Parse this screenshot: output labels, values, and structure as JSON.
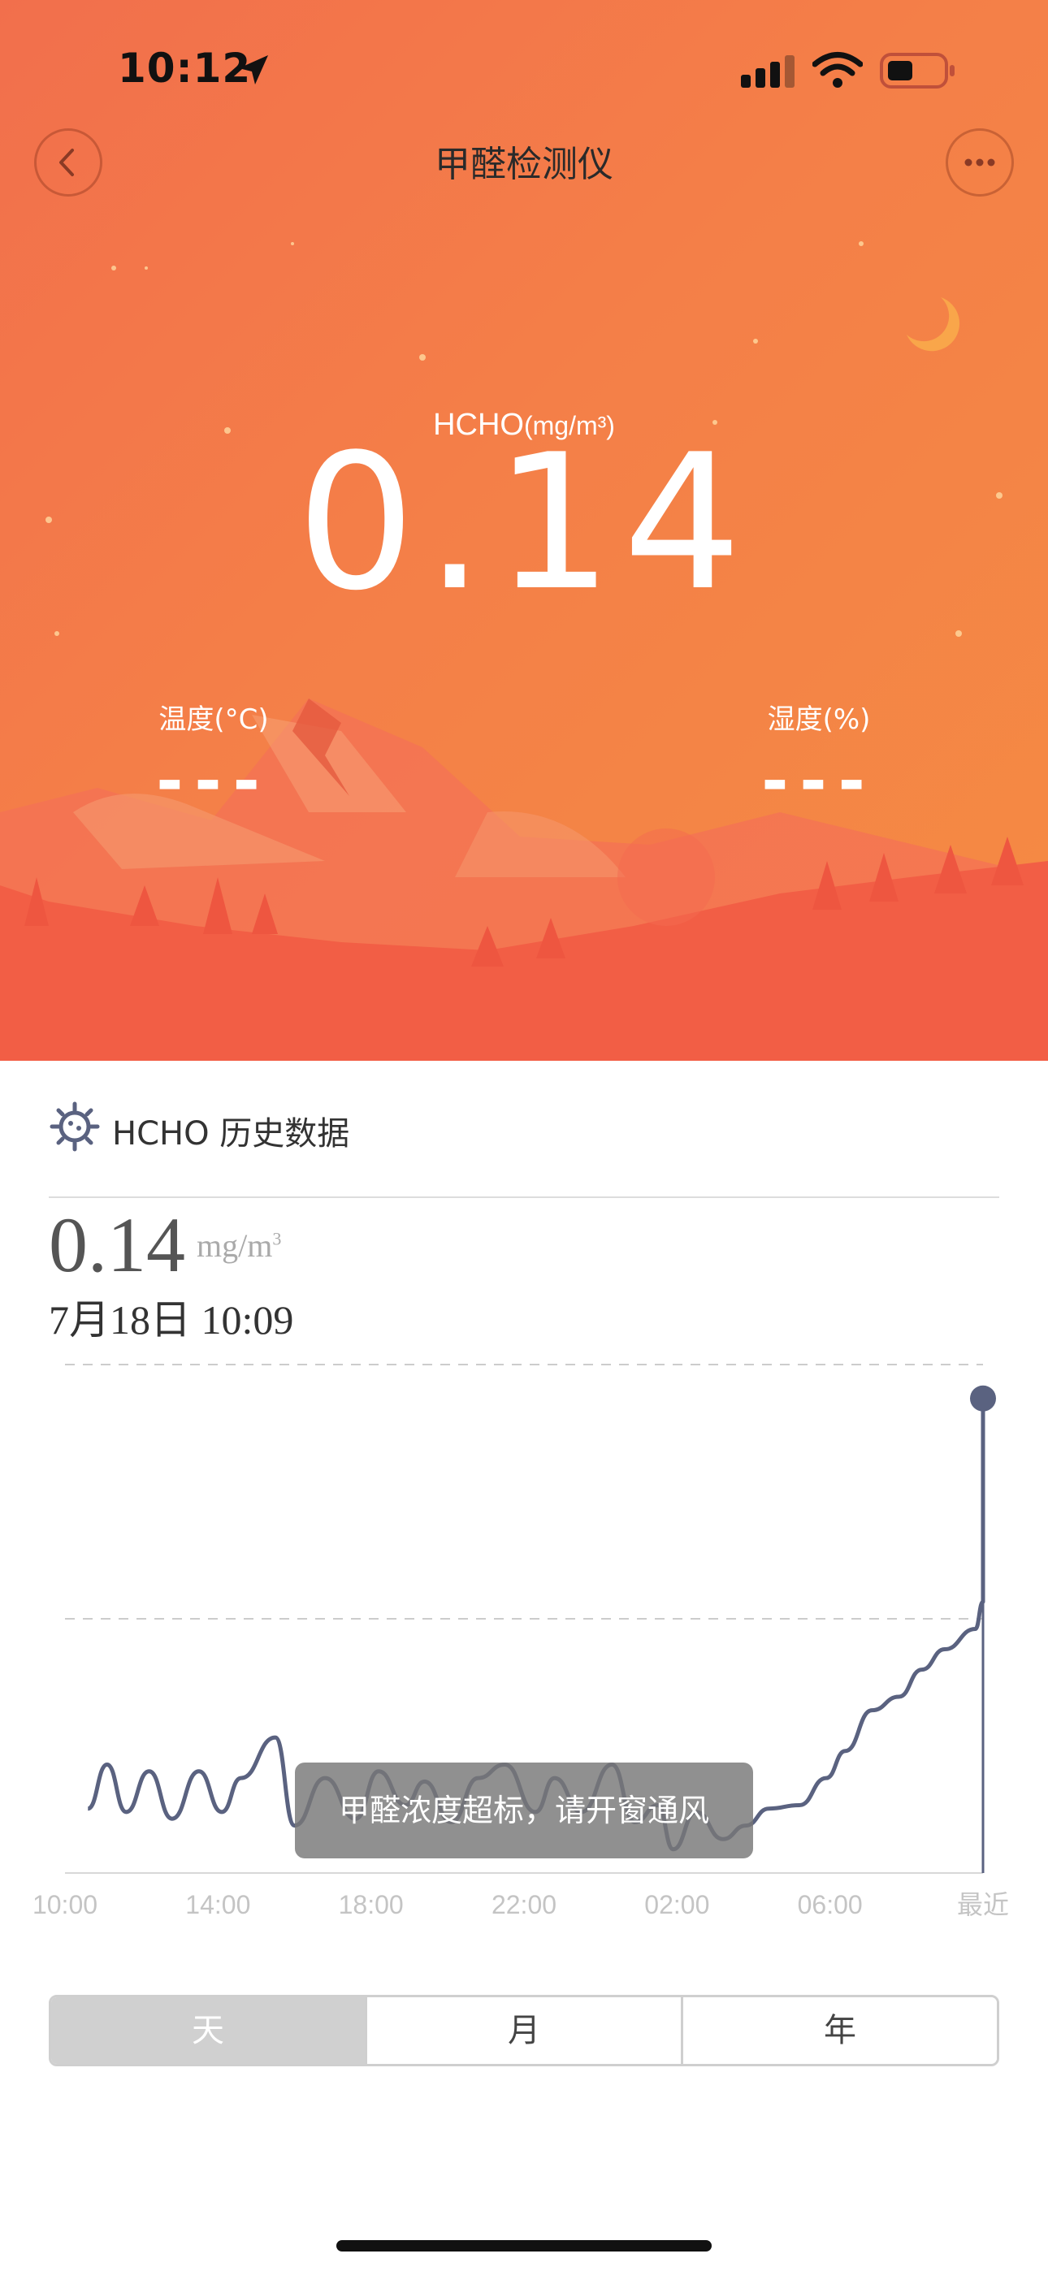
{
  "status_bar": {
    "time": "10:12",
    "icons": [
      "location-arrow-icon",
      "signal-icon",
      "wifi-icon",
      "battery-icon"
    ]
  },
  "nav": {
    "title": "甲醛检测仪",
    "back_icon": "chevron-left-icon",
    "more_icon": "ellipsis-icon"
  },
  "reading": {
    "label": "HCHO",
    "unit": "(mg/m³)",
    "value": "0.14"
  },
  "metrics": {
    "temperature_label": "温度(°C)",
    "temperature_value": "---",
    "humidity_label": "湿度(%)",
    "humidity_value": "---"
  },
  "history": {
    "title": "HCHO 历史数据",
    "icon": "gear-icon",
    "current_value": "0.14",
    "current_unit": "mg/m",
    "current_unit_sup": "3",
    "current_date": "7月18日 10:09"
  },
  "chart_data": {
    "type": "line",
    "x_labels": [
      "10:00",
      "14:00",
      "18:00",
      "22:00",
      "02:00",
      "06:00",
      "最近"
    ],
    "x_range": [
      0,
      24
    ],
    "y_range": [
      0,
      0.15
    ],
    "series": [
      {
        "values": [
          [
            0.6,
            0.019
          ],
          [
            1.1,
            0.032
          ],
          [
            1.6,
            0.018
          ],
          [
            2.2,
            0.03
          ],
          [
            2.8,
            0.016
          ],
          [
            3.5,
            0.03
          ],
          [
            4.1,
            0.018
          ],
          [
            4.6,
            0.028
          ],
          [
            5.5,
            0.04
          ],
          [
            6.0,
            0.014
          ],
          [
            6.8,
            0.028
          ],
          [
            7.6,
            0.016
          ],
          [
            8.2,
            0.03
          ],
          [
            8.9,
            0.02
          ],
          [
            9.4,
            0.027
          ],
          [
            10.1,
            0.015
          ],
          [
            10.8,
            0.028
          ],
          [
            11.5,
            0.032
          ],
          [
            12.3,
            0.018
          ],
          [
            12.8,
            0.028
          ],
          [
            13.5,
            0.018
          ],
          [
            14.3,
            0.032
          ],
          [
            14.9,
            0.015
          ],
          [
            15.5,
            0.02
          ],
          [
            15.9,
            0.007
          ],
          [
            16.5,
            0.018
          ],
          [
            17.2,
            0.01
          ],
          [
            17.8,
            0.014
          ],
          [
            18.4,
            0.019
          ],
          [
            19.2,
            0.02
          ],
          [
            19.9,
            0.028
          ],
          [
            20.4,
            0.036
          ],
          [
            21.1,
            0.048
          ],
          [
            21.8,
            0.052
          ],
          [
            22.4,
            0.06
          ],
          [
            23.0,
            0.066
          ],
          [
            23.8,
            0.072
          ],
          [
            24.5,
            0.08
          ],
          [
            25.2,
            0.09
          ],
          [
            25.8,
            0.1
          ],
          [
            26.6,
            0.106
          ],
          [
            27.1,
            0.11
          ],
          [
            27.8,
            0.116
          ],
          [
            28.4,
            0.124
          ],
          [
            29.0,
            0.13
          ],
          [
            29.7,
            0.133
          ],
          [
            30.2,
            0.137
          ],
          [
            30.9,
            0.14
          ]
        ]
      }
    ],
    "grid": "horizontal-dashed",
    "end_marker": true
  },
  "toast": "甲醛浓度超标，请开窗通风",
  "segments": [
    "天",
    "月",
    "年"
  ],
  "active_segment": 0,
  "colors": {
    "hero_start": "#f26f4c",
    "hero_end": "#f58b43",
    "line": "#5a6280",
    "segment_active": "#d0d0d0"
  }
}
